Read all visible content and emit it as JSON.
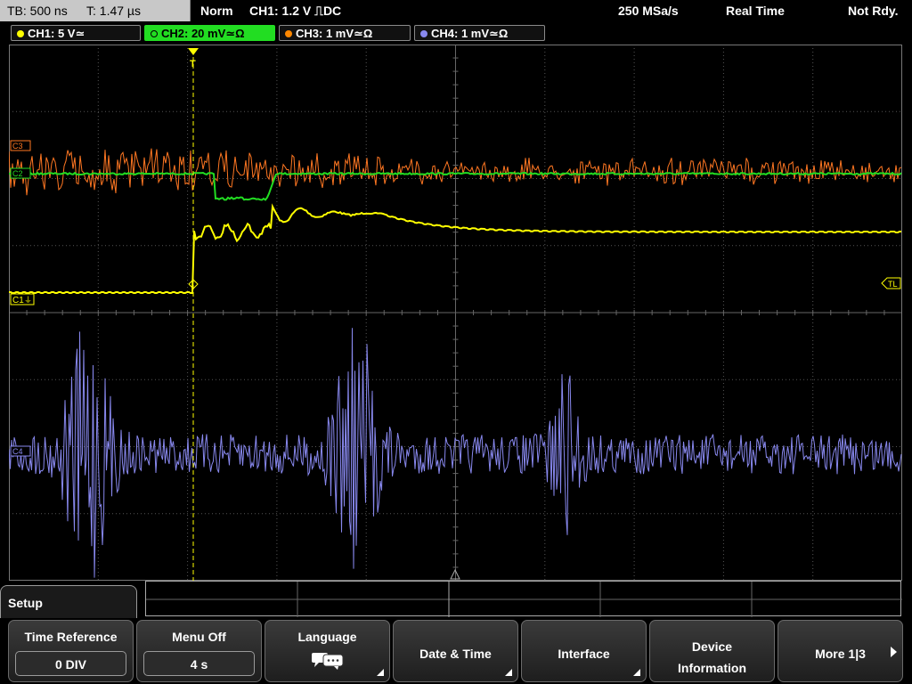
{
  "top": {
    "timebase": "TB: 500 ns",
    "trigger_time": "T: 1.47 µs",
    "mode": "Norm",
    "trigger": "CH1: 1.2 V ⎍DC",
    "sample_rate": "250 MSa/s",
    "acq": "Real Time",
    "ready": "Not Rdy."
  },
  "channels": [
    {
      "label": "CH1: 5 V≃",
      "color": "#ffff00"
    },
    {
      "label": "CH2: 20 mV≃Ω",
      "color": "#22dd22"
    },
    {
      "label": "CH3: 1 mV≃Ω",
      "color": "#ff8800"
    },
    {
      "label": "CH4: 1 mV≃Ω",
      "color": "#8888ee"
    }
  ],
  "markers": {
    "c1": "C1",
    "c2": "C2",
    "c3": "C3",
    "c4": "C4",
    "trigger_level": "TL",
    "trigger_pos": "T"
  },
  "colors": {
    "ch1": "#ffff00",
    "ch2": "#22dd22",
    "ch3": "#ff7722",
    "ch4": "#8888ee",
    "grid": "#555555"
  },
  "menu": {
    "title": "Setup",
    "softkeys": [
      {
        "label": "Time Reference",
        "value": "0 DIV"
      },
      {
        "label": "Menu Off",
        "value": "4 s"
      },
      {
        "label": "Language",
        "icon": "speech-bubbles-icon"
      },
      {
        "label": "Date & Time"
      },
      {
        "label": "Interface"
      },
      {
        "label": "Device\nInformation"
      },
      {
        "label": "More 1|3"
      }
    ]
  }
}
